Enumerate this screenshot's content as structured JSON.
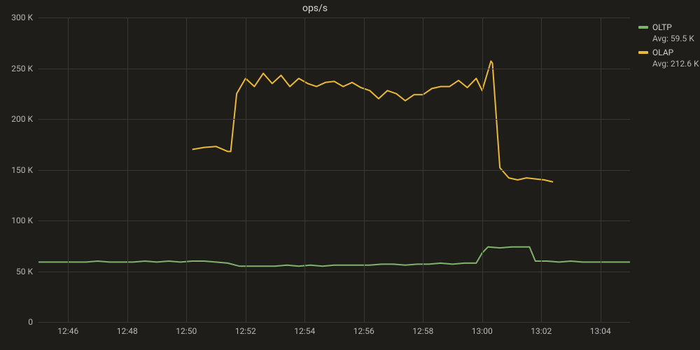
{
  "chart_data": {
    "type": "line",
    "title": "ops/s",
    "xlabel": "",
    "ylabel": "",
    "ylim": [
      0,
      300
    ],
    "xlim": [
      765,
      785
    ],
    "y_ticks": [
      0,
      50,
      100,
      150,
      200,
      250,
      300
    ],
    "y_tick_labels": [
      "0",
      "50 K",
      "100 K",
      "150 K",
      "200 K",
      "250 K",
      "300 K"
    ],
    "x_ticks": [
      766,
      768,
      770,
      772,
      774,
      776,
      778,
      780,
      782,
      784
    ],
    "x_tick_labels": [
      "12:46",
      "12:48",
      "12:50",
      "12:52",
      "12:54",
      "12:56",
      "12:58",
      "13:00",
      "13:02",
      "13:04"
    ],
    "series": [
      {
        "name": "OLTP",
        "color": "#7eb26d",
        "avg_label": "Avg: 59.5 K",
        "x": [
          765.0,
          765.4,
          765.8,
          766.2,
          766.6,
          767.0,
          767.4,
          767.8,
          768.2,
          768.6,
          769.0,
          769.4,
          769.8,
          770.2,
          770.6,
          771.0,
          771.4,
          771.8,
          772.2,
          772.6,
          773.0,
          773.4,
          773.8,
          774.2,
          774.6,
          775.0,
          775.4,
          775.8,
          776.2,
          776.6,
          777.0,
          777.4,
          777.8,
          778.2,
          778.6,
          779.0,
          779.4,
          779.8,
          780.0,
          780.2,
          780.6,
          781.0,
          781.4,
          781.6,
          781.8,
          782.2,
          782.6,
          783.0,
          783.4,
          783.8,
          784.2,
          784.6,
          785.0
        ],
        "y": [
          59,
          59,
          59,
          59,
          59,
          60,
          59,
          59,
          59,
          60,
          59,
          60,
          59,
          60,
          60,
          59,
          58,
          55,
          55,
          55,
          55,
          56,
          55,
          56,
          55,
          56,
          56,
          56,
          56,
          57,
          57,
          56,
          57,
          57,
          58,
          57,
          58,
          58,
          68,
          74,
          73,
          74,
          74,
          74,
          60,
          60,
          59,
          60,
          59,
          59,
          59,
          59,
          59
        ]
      },
      {
        "name": "OLAP",
        "color": "#eab839",
        "avg_label": "Avg: 212.6 K",
        "x": [
          770.2,
          770.6,
          771.0,
          771.4,
          771.5,
          771.7,
          772.0,
          772.3,
          772.6,
          772.9,
          773.2,
          773.5,
          773.8,
          774.1,
          774.4,
          774.7,
          775.0,
          775.3,
          775.6,
          775.9,
          776.2,
          776.5,
          776.8,
          777.1,
          777.4,
          777.7,
          778.0,
          778.3,
          778.6,
          778.9,
          779.2,
          779.5,
          779.8,
          780.0,
          780.3,
          780.35,
          780.6,
          780.9,
          781.2,
          781.5,
          781.8,
          782.1,
          782.4
        ],
        "y": [
          170,
          172,
          173,
          168,
          168,
          225,
          240,
          232,
          245,
          235,
          243,
          232,
          240,
          235,
          232,
          236,
          237,
          232,
          236,
          231,
          228,
          220,
          228,
          225,
          218,
          224,
          224,
          230,
          232,
          232,
          238,
          231,
          240,
          228,
          257,
          255,
          152,
          142,
          140,
          142,
          141,
          140,
          138
        ]
      }
    ],
    "legend_position": "right"
  }
}
